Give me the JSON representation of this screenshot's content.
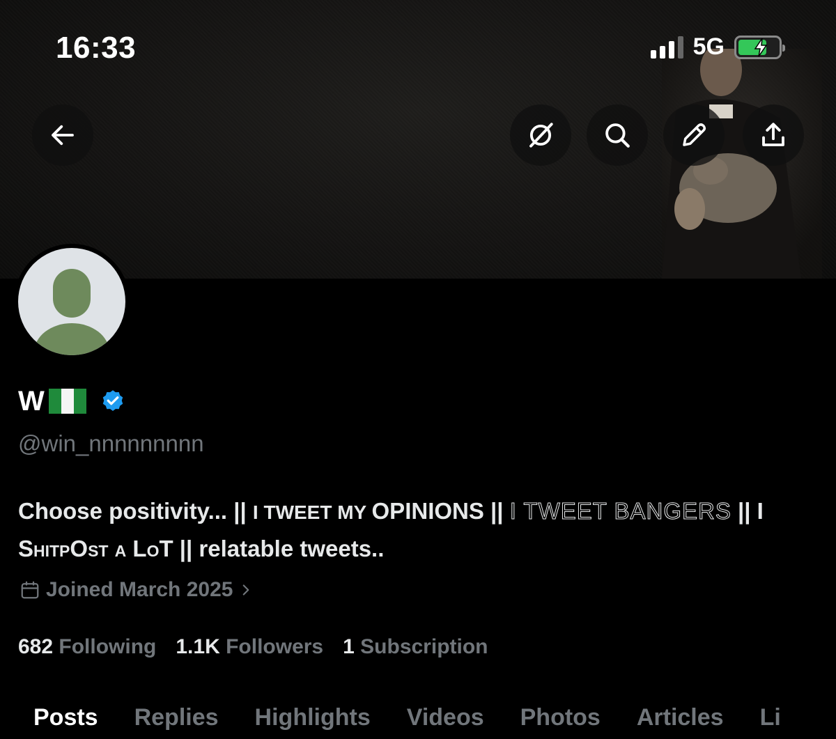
{
  "status_bar": {
    "time": "16:33",
    "network": "5G",
    "signal_bars_active": 3,
    "battery_level": 0.7,
    "battery_charging": true
  },
  "header": {
    "back_icon": "arrow-left-icon",
    "actions": [
      {
        "name": "grok-icon"
      },
      {
        "name": "search-icon"
      },
      {
        "name": "pencil-icon"
      },
      {
        "name": "share-icon"
      }
    ]
  },
  "profile": {
    "display_name": "W",
    "flag": "🇳🇬",
    "verified": true,
    "handle": "@win_nnnnnnnnn",
    "bio": {
      "part1": "Choose positivity... || ",
      "part2": "I TWEET MY ",
      "part3": "OPINIONS || ",
      "part4": "I TWEET BANGERS",
      "part5": " || ",
      "part6": "I ShitpOst a LoT",
      "part7": " || relatable tweets.."
    },
    "joined": "Joined March 2025",
    "stats": {
      "following_count": "682",
      "following_label": "Following",
      "followers_count": "1.1K",
      "followers_label": "Followers",
      "subscriptions_count": "1",
      "subscriptions_label": "Subscription"
    }
  },
  "tabs": [
    "Posts",
    "Replies",
    "Highlights",
    "Videos",
    "Photos",
    "Articles",
    "Li"
  ],
  "colors": {
    "background": "#000000",
    "muted_text": "#71767b",
    "verified_blue": "#1d9bf0",
    "avatar_green": "#6e8a5c",
    "avatar_bg": "#dfe3e7"
  }
}
